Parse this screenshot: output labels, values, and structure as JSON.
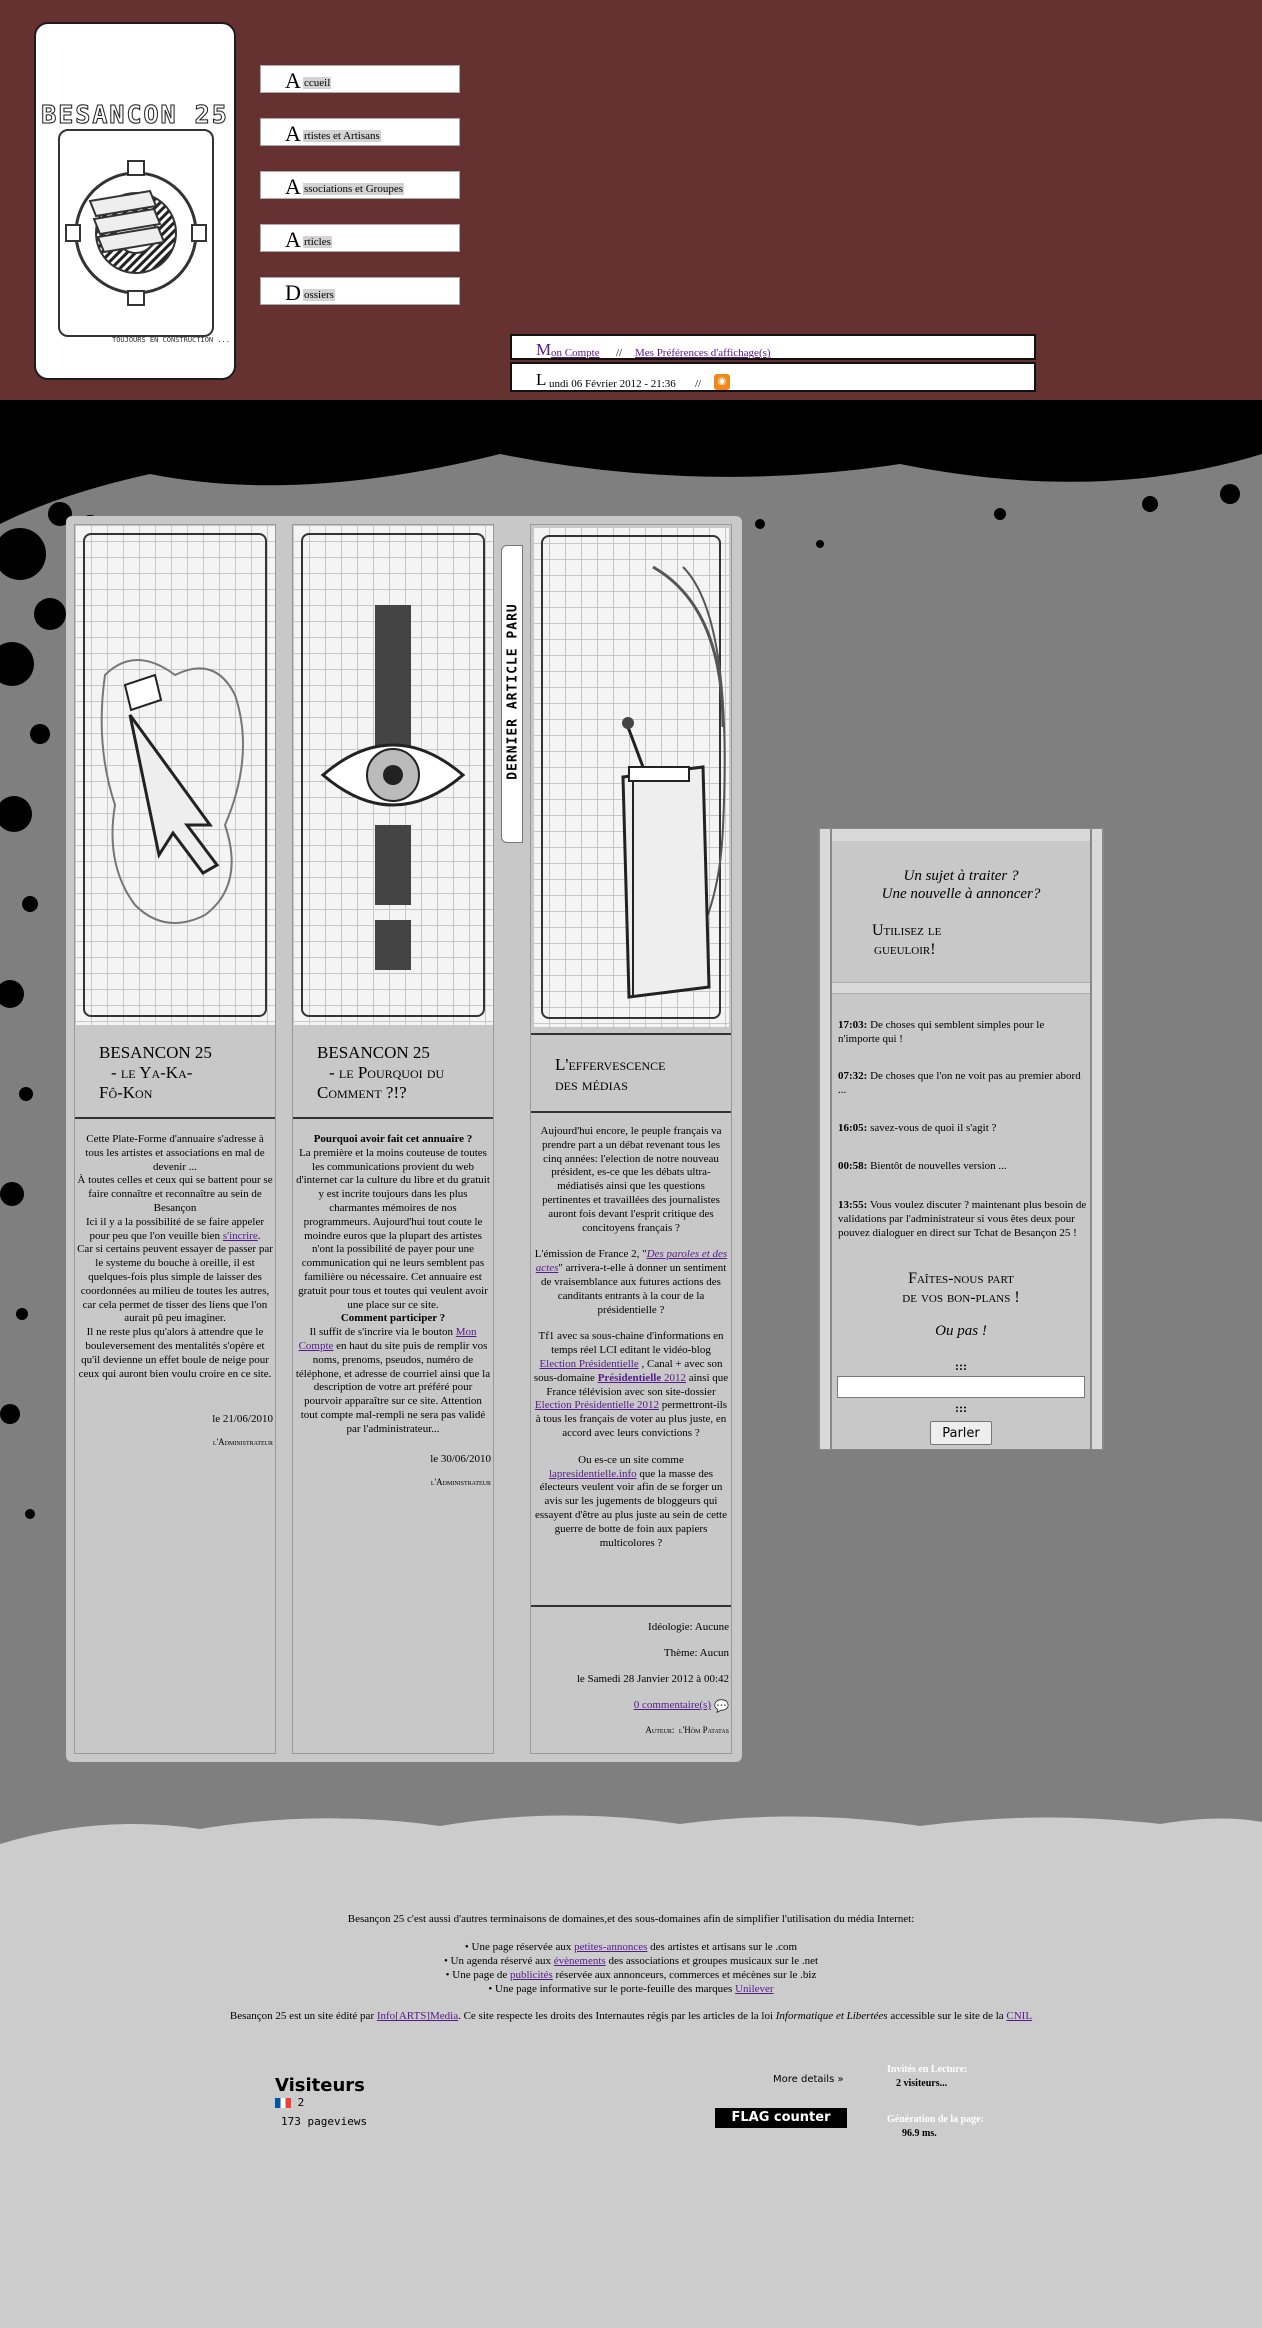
{
  "header": {
    "logo_title": "BESANCON 25",
    "logo_tagline": "TOUJOURS EN CONSTRUCTION ...",
    "nav": [
      {
        "cap": "A",
        "rest": "ccueil"
      },
      {
        "cap": "A",
        "rest": "rtistes et Artisans"
      },
      {
        "cap": "A",
        "rest": "ssociations et Groupes"
      },
      {
        "cap": "A",
        "rest": "rticles"
      },
      {
        "cap": "D",
        "rest": "ossiers"
      }
    ],
    "account": {
      "cap": "M",
      "rest": "on Compte",
      "sep": "//",
      "prefs": "Mes Préférences d'affichage(s)"
    },
    "date": {
      "cap": "L",
      "rest": "undi 06 Février 2012 - 21:36",
      "sep": "//"
    }
  },
  "vertical_tab": "DERNIER ARTICLE PARU",
  "articles": [
    {
      "title_line1": "BESANCON 25",
      "title_line2": "- le Ya-Ka-",
      "title_line3": "Fô-Kon",
      "p1": "Cette Plate-Forme d'annuaire s'adresse à tous les artistes et associations en mal de devenir ...",
      "p2": "À toutes celles et ceux qui se battent pour se faire connaître et reconnaître au sein de Besançon",
      "p3a": "Ici il y a la possibilité de se faire appeler pour peu que l'on veuille bien ",
      "p3link": "s'incrire",
      "p3b": ".",
      "p4": "Car si certains peuvent essayer de passer par le systeme du bouche à oreille, il est quelques-fois plus simple de laisser des coordonnées au milieu de toutes les autres, car cela permet de tisser des liens que l'on aurait pû peu imaginer.",
      "p5": "Il ne reste plus qu'alors à attendre que le bouleversement des mentalités s'opère et qu'il devienne un effet boule de neige pour ceux qui auront bien voulu croire en ce site.",
      "date": "le 21/06/2010",
      "author": "l'Administrateur"
    },
    {
      "title_line1": "BESANCON 25",
      "title_line2": "- le Pourquoi du",
      "title_line3": "Comment ?!?",
      "h1": "Pourquoi avoir fait cet annuaire ?",
      "p1": "La première et la moins couteuse de toutes les communications provient du web d'internet car la culture du libre et du gratuit y est incrite toujours dans les plus charmantes mémoires de nos programmeurs. Aujourd'hui tout coute le moindre euros que la plupart des artistes n'ont la possibilité de payer pour une communication qui ne leurs semblent pas familière ou nécessaire. Cet annuaire est gratuit pour tous et toutes qui veulent avoir une place sur ce site.",
      "h2": "Comment participer ?",
      "p2a": "Il suffit de s'incrire via le bouton ",
      "p2link": "Mon Compte",
      "p2b": " en haut du site puis de remplir vos noms, prenoms, pseudos, numéro de téléphone, et adresse de courriel ainsi que la description de votre art préféré pour pourvoir apparaître sur ce site. Attention tout compte mal-rempli ne sera pas validé par l'administrateur...",
      "date": "le 30/06/2010",
      "author": "l'Administrateur"
    },
    {
      "title_line1": "L'effervescence",
      "title_line2": "des médias",
      "p1": "Aujourd'hui encore, le peuple français va prendre part a un débat revenant tous les cinq années: l'election de notre nouveau président, es-ce que les débats ultra-médiatisés ainsi que les questions pertinentes et travaillées des journalistes auront fois devant l'esprit critique des concitoyens français ?",
      "p2a": "L'émission de France 2, \"",
      "p2link": "Des paroles et des actes",
      "p2b": "\" arrivera-t-elle à donner un sentiment de vraisemblance aux futures actions des canditants entrants à la cour de la présidentielle ?",
      "p3a": "Tf1 avec sa sous-chaine d'informations en temps réel LCI editant le vidéo-blog ",
      "p3link1": "Election Présidentielle",
      "p3b": " , Canal + avec son sous-domaine ",
      "p3link2": "Présidentielle",
      "p3link2b": " 2012",
      "p3c": " ainsi que France télévision avec son site-dossier ",
      "p3link3": "Election Présidentielle 2012",
      "p3d": " permettront-ils à tous les français de voter au plus juste, en accord avec leurs convictions ?",
      "p4a": "Ou es-ce un site comme ",
      "p4link": "lapresidentielle.info",
      "p4b": " que la masse des électeurs veulent voir afin de se forger un avis sur les jugements de bloggeurs qui essayent d'être au plus juste au sein de cette guerre de botte de foin aux papiers multicolores ?",
      "ideology": "Idéologie:  Aucune",
      "theme": "Thème:  Aucun",
      "date": "le Samedi 28 Janvier 2012 à 00:42",
      "comments": "0 commentaire(s)",
      "author_label": "Auteur:",
      "author": "l'Hôm Patatas"
    }
  ],
  "sidebar": {
    "q1": "Un sujet à traiter ?",
    "q2": "Une nouvelle à annoncer?",
    "cta1": "Utilisez le",
    "cta2": "gueuloir!",
    "messages": [
      {
        "time": "17:03:",
        "text": " De choses qui semblent simples pour le n'importe qui !"
      },
      {
        "time": "07:32:",
        "text": " De choses que l'on ne voit pas au premier abord ..."
      },
      {
        "time": "16:05:",
        "text": " savez-vous de quoi il s'agit ?"
      },
      {
        "time": "00:58:",
        "text": " Bientôt de nouvelles version ..."
      },
      {
        "time": "13:55:",
        "text": " Vous voulez discuter ? maintenant plus besoin de validations par l'administrateur si vous êtes deux pour pouvez dialoguer en direct sur Tchat de Besançon 25 !"
      }
    ],
    "join1": "Faîtes-nous part",
    "join2": "de vos bon-plans !",
    "orpas": "Ou pas !",
    "sep": ":::",
    "button": "Parler"
  },
  "footer": {
    "intro": "Besançon 25 c'est aussi d'autres terminaisons de domaines,et des sous-domaines afin de simplifier l'utilisation du média Internet:",
    "items": [
      {
        "a": "Une page réservée aux ",
        "link": "petites-annonces",
        "b": " des artistes et artisans sur le .com"
      },
      {
        "a": "Un agenda réservé aux ",
        "link": "évènements",
        "b": " des associations et groupes musicaux sur le .net"
      },
      {
        "a": "Une page de ",
        "link": "publicités",
        "b": " réservée aux annonceurs, commerces et mécènes sur le .biz"
      },
      {
        "a": "Une page informative sur le porte-feuille des marques ",
        "link": "Unilever",
        "b": ""
      }
    ],
    "legal_a": "Besançon 25 est un site édité par ",
    "legal_link1": "Info[ARTS]Media",
    "legal_b": ". Ce site respecte les droits des Internautes régis par les articles de la loi ",
    "legal_i": "Informatique et Libertées",
    "legal_c": " accessible sur le site de la ",
    "legal_link2": "CNIL",
    "visitors_title": "Visiteurs",
    "visitors_count": "2",
    "pageviews": "173 pageviews",
    "more_details": "More details »",
    "flag_counter": "FLAG counter",
    "invites_label": "Invités en Lecture:",
    "invites_value": "2 visiteurs...",
    "gen_label": "Génération de la page:",
    "gen_value": "96.9 ms."
  }
}
